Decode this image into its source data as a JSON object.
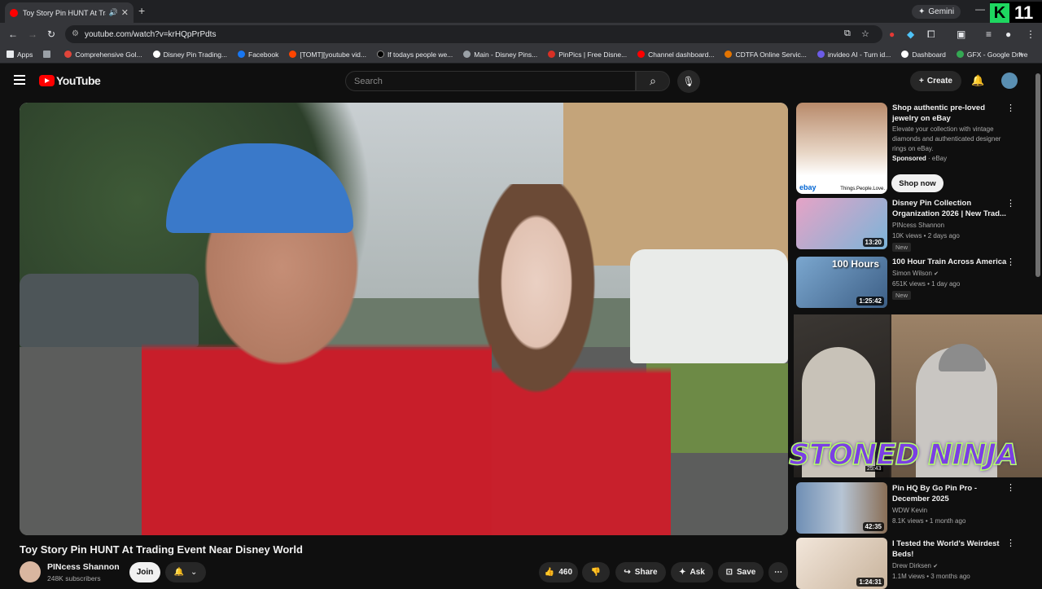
{
  "browser": {
    "tab_title": "Toy Story Pin HUNT At Trading Event Near Disney World",
    "new_tab": "+",
    "gemini": "Gemini",
    "url": "youtube.com/watch?v=krHQpPrPdts",
    "overlay_logo_num": "11"
  },
  "bookmarks": [
    {
      "label": "Apps",
      "color": "#e8eaed"
    },
    {
      "label": "Comprehensive Gol...",
      "color": "#e0453a"
    },
    {
      "label": "Disney Pin Trading...",
      "color": "#ffffff"
    },
    {
      "label": "Facebook",
      "color": "#1877f2"
    },
    {
      "label": "[TOMT][youtube vid...",
      "color": "#ff4500"
    },
    {
      "label": "If todays people we...",
      "color": "#000000"
    },
    {
      "label": "Main - Disney Pins...",
      "color": "#9aa0a6"
    },
    {
      "label": "PinPics | Free Disne...",
      "color": "#d93025"
    },
    {
      "label": "Channel dashboard...",
      "color": "#ff0000"
    },
    {
      "label": "CDTFA Online Servic...",
      "color": "#e37400"
    },
    {
      "label": "invideo AI - Turn id...",
      "color": "#6c5ce7"
    },
    {
      "label": "Dashboard",
      "color": "#ffffff"
    },
    {
      "label": "GFX - Google Drive",
      "color": "#34a853"
    }
  ],
  "youtube": {
    "logo_text": "YouTube",
    "search_placeholder": "Search",
    "create_label": "Create"
  },
  "video": {
    "title": "Toy Story Pin HUNT At Trading Event Near Disney World",
    "channel": "PINcess Shannon",
    "subscribers": "248K subscribers",
    "join_label": "Join",
    "likes": "460",
    "share_label": "Share",
    "ask_label": "Ask",
    "save_label": "Save"
  },
  "ad": {
    "title": "Shop authentic pre-loved jewelry on eBay",
    "description": "Elevate your collection with vintage diamonds and authenticated designer rings on eBay.",
    "sponsored": "Sponsored",
    "advertiser": "eBay",
    "cta": "Shop now",
    "img_logo": "ebay",
    "img_tagline": "Things.People.Love."
  },
  "recommendations": [
    {
      "title": "Disney Pin Collection Organization 2026 | New Trad...",
      "channel": "PINcess Shannon",
      "meta": "10K views • 2 days ago",
      "duration": "13:20",
      "badge": "New",
      "thumb": "#c46a9a"
    },
    {
      "title": "100 Hour Train Across America",
      "channel": "Simon Wilson",
      "meta": "651K views • 1 day ago",
      "duration": "1:25:42",
      "badge": "New",
      "thumb_text": "100 Hours",
      "thumb": "#4a7fb0"
    },
    {
      "title": "Pin HQ By Go Pin Pro - December 2025",
      "channel": "WDW Kevin",
      "meta": "8.1K views • 1 month ago",
      "duration": "42:35",
      "thumb": "#5c6f8a"
    },
    {
      "title": "I Tested the World's Weirdest Beds!",
      "channel": "Drew Dirksen",
      "meta": "1.1M views • 3 months ago",
      "duration": "1:24:31",
      "thumb": "#d9c8b8"
    }
  ],
  "overlay": {
    "text": "STONED NINJA",
    "hidden_duration": "25:43"
  }
}
